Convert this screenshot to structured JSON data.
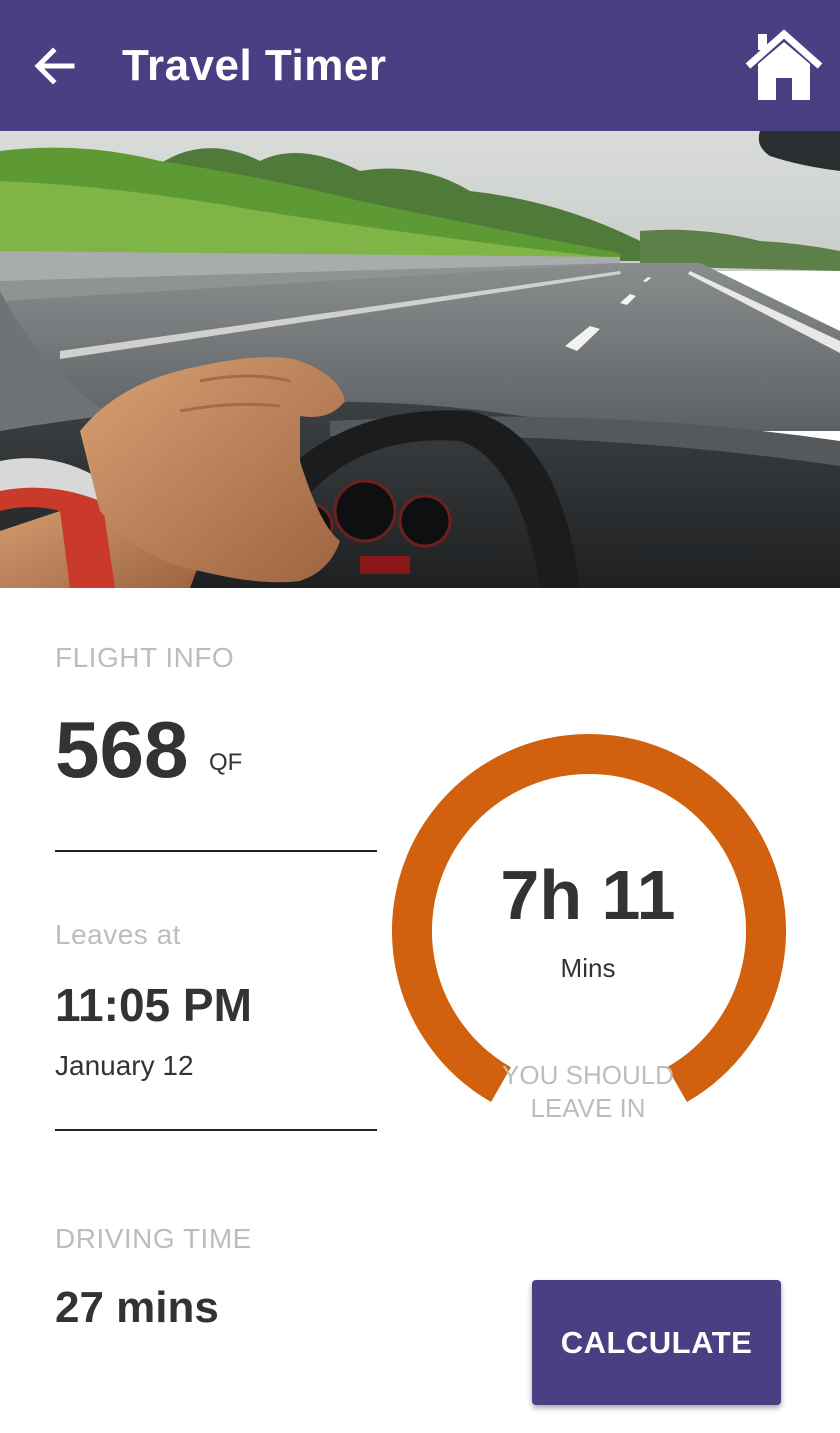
{
  "appbar": {
    "title": "Travel Timer",
    "back_icon": "arrow-left-icon",
    "home_icon": "home-icon",
    "background_color": "#4a3f82"
  },
  "hero": {
    "image_description": "driver-hand-on-steering-wheel-highway"
  },
  "flight_info": {
    "label": "FLIGHT INFO",
    "number": "568",
    "airline_code": "QF"
  },
  "departure": {
    "label": "Leaves at",
    "time": "11:05 PM",
    "date": "January 12"
  },
  "driving": {
    "label": "DRIVING TIME",
    "value": "27 mins"
  },
  "countdown": {
    "value": "7h 11",
    "unit": "Mins",
    "caption_line1": "YOU SHOULD",
    "caption_line2": "LEAVE IN",
    "ring_color": "#d2610f"
  },
  "actions": {
    "calculate_label": "CALCULATE"
  }
}
